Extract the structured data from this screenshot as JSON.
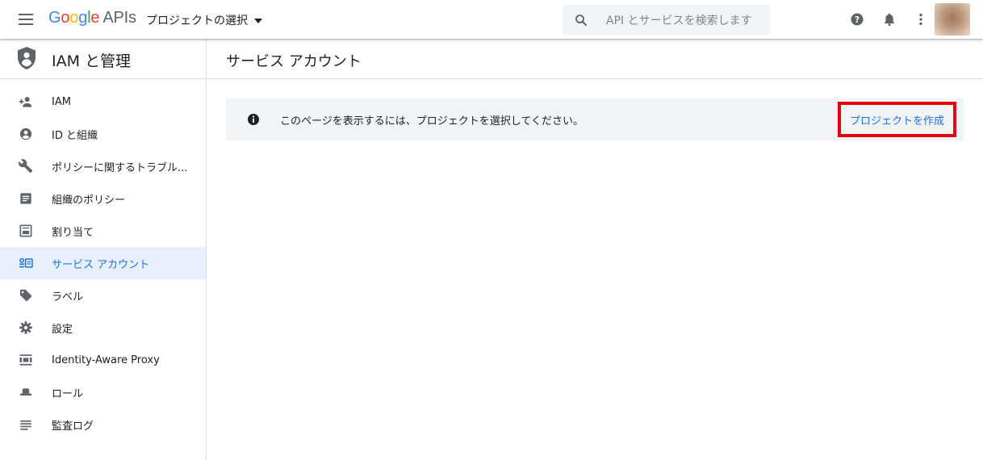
{
  "header": {
    "logo_google": "Google",
    "logo_apis": "APIs",
    "project_selector": "プロジェクトの選択",
    "search_placeholder": "API とサービスを検索します",
    "icons": [
      "menu-icon",
      "search-icon",
      "help-icon",
      "notifications-icon",
      "more-vert-icon"
    ]
  },
  "sidebar": {
    "title": "IAM と管理",
    "items": [
      {
        "label": "IAM",
        "icon": "person-add-icon",
        "active": false
      },
      {
        "label": "ID と組織",
        "icon": "account-circle-icon",
        "active": false
      },
      {
        "label": "ポリシーに関するトラブル...",
        "icon": "wrench-icon",
        "active": false
      },
      {
        "label": "組織のポリシー",
        "icon": "policy-doc-icon",
        "active": false
      },
      {
        "label": "割り当て",
        "icon": "quota-icon",
        "active": false
      },
      {
        "label": "サービス アカウント",
        "icon": "service-account-icon",
        "active": true
      },
      {
        "label": "ラベル",
        "icon": "label-tag-icon",
        "active": false
      },
      {
        "label": "設定",
        "icon": "gear-icon",
        "active": false
      },
      {
        "label": "Identity-Aware Proxy",
        "icon": "proxy-icon",
        "active": false
      },
      {
        "label": "ロール",
        "icon": "role-hat-icon",
        "active": false
      },
      {
        "label": "監査ログ",
        "icon": "list-lines-icon",
        "active": false
      }
    ]
  },
  "main": {
    "page_title": "サービス アカウント",
    "banner_message": "このページを表示するには、プロジェクトを選択してください。",
    "create_project_label": "プロジェクトを作成"
  },
  "colors": {
    "accent": "#1a73e8",
    "active_bg": "#e8f0fe",
    "highlight_border": "#e8000a",
    "banner_bg": "#f1f3f4"
  }
}
